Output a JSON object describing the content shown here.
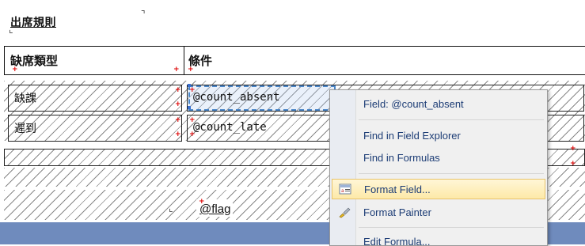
{
  "report": {
    "section_title": "出席規則",
    "columns": [
      {
        "label": "缺席類型"
      },
      {
        "label": "條件"
      }
    ],
    "rows": [
      {
        "type": "缺課",
        "condition": "@count_absent"
      },
      {
        "type": "遲到",
        "condition": "@count_late"
      }
    ],
    "flag_field": "@flag"
  },
  "context_menu": {
    "items": [
      {
        "label": "Field: @count_absent",
        "icon": ""
      },
      {
        "label": "Find in Field Explorer",
        "icon": ""
      },
      {
        "label": "Find in Formulas",
        "icon": ""
      },
      {
        "label": "Format Field...",
        "icon": "format-field-icon",
        "highlighted": true
      },
      {
        "label": "Format Painter",
        "icon": "format-painter-icon"
      },
      {
        "label": "Edit Formula...",
        "icon": ""
      }
    ]
  },
  "colors": {
    "menu_text": "#1c3c75",
    "highlight": "#fde9a8",
    "bottom_band": "#6f8bbd",
    "selection": "#4a86c8"
  }
}
